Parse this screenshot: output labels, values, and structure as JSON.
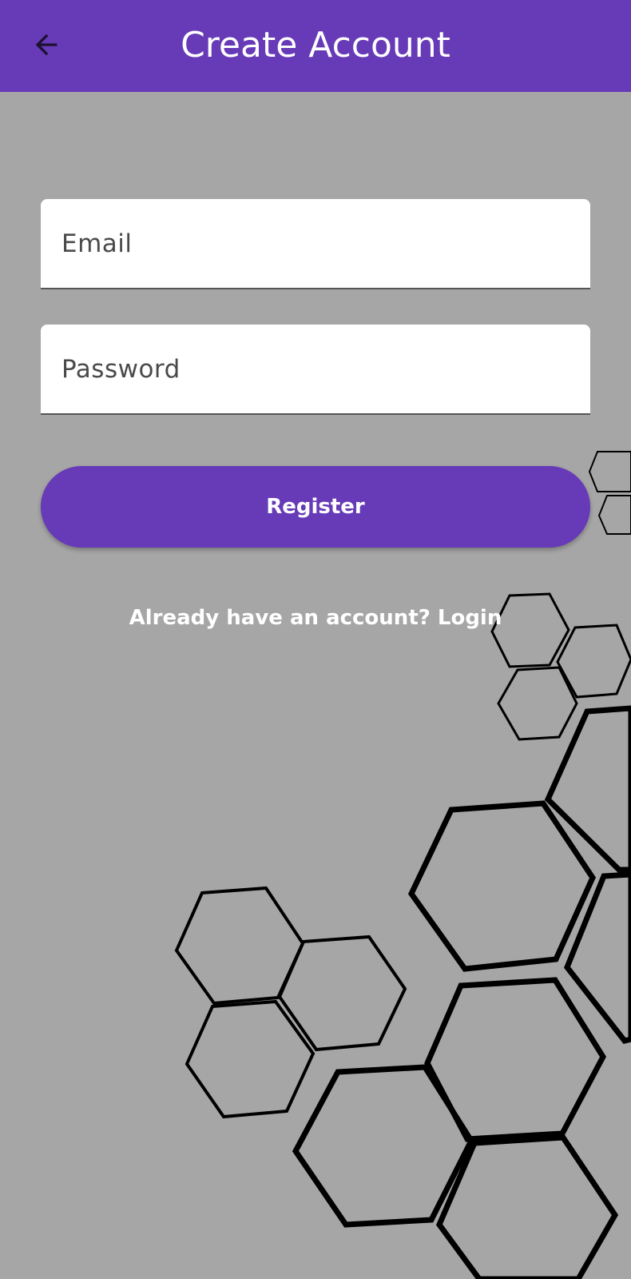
{
  "app_bar": {
    "title": "Create Account",
    "back_icon": "arrow-left-icon",
    "background": "#673ab7"
  },
  "form": {
    "email_placeholder": "Email",
    "email_value": "",
    "password_placeholder": "Password",
    "password_value": "",
    "register_label": "Register",
    "login_prompt": "Already have an account?",
    "login_link": "Login"
  },
  "colors": {
    "background": "#a6a6a6",
    "primary": "#673ab7",
    "field": "#ffffff"
  },
  "decoration": {
    "pattern_icon": "hexagon-pattern"
  }
}
